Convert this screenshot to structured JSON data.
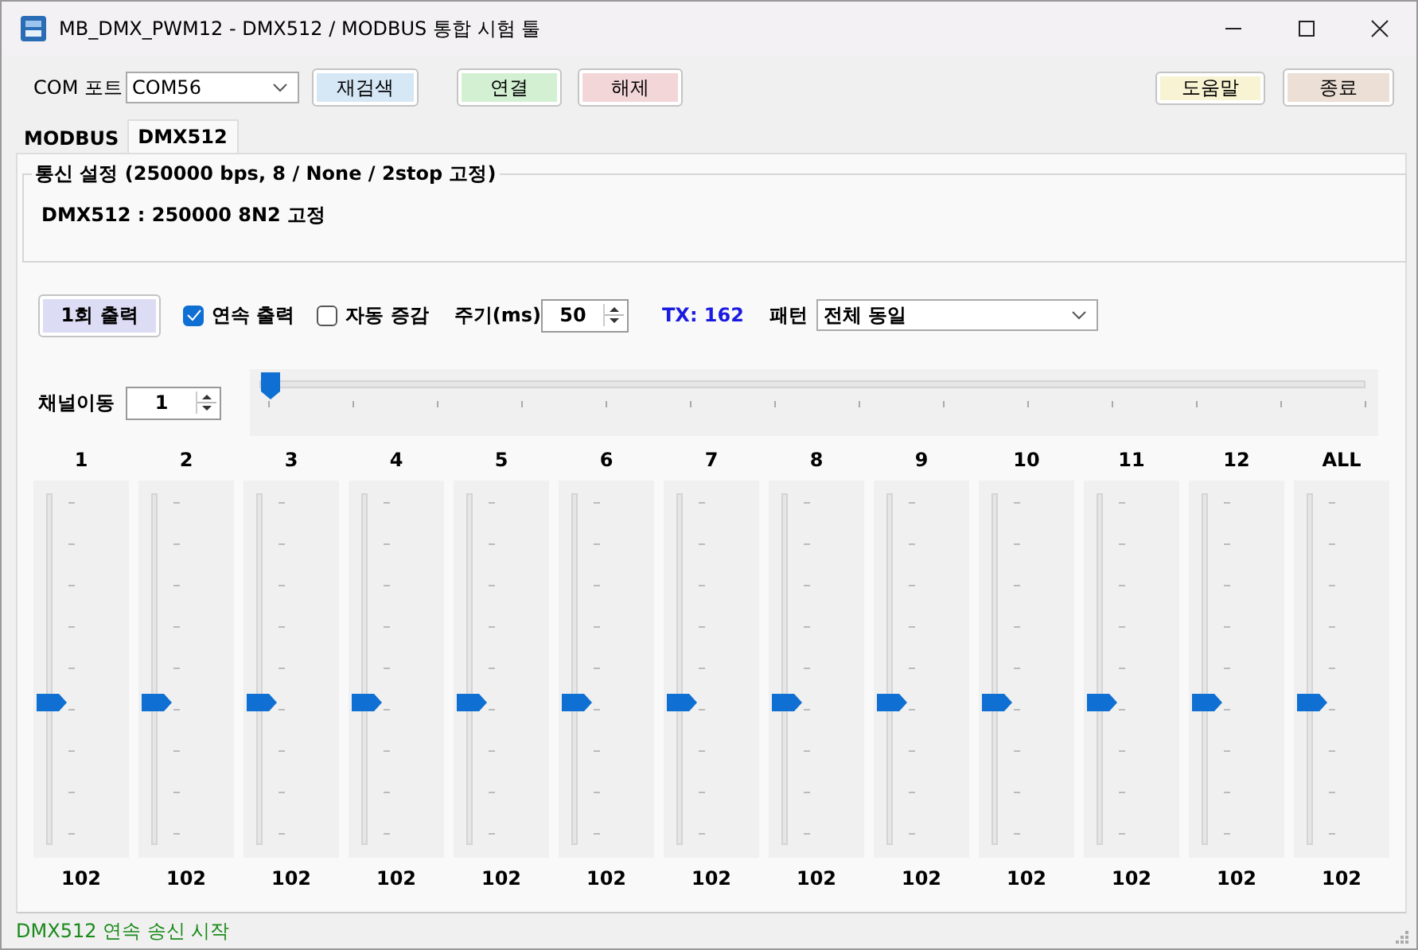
{
  "window": {
    "title": "MB_DMX_PWM12 - DMX512 / MODBUS 통합 시험 툴"
  },
  "toolbar": {
    "port_label": "COM 포트",
    "port": "COM56",
    "buttons": [
      {
        "label": "재검색",
        "color": "#d6e7f5"
      },
      {
        "label": "연결",
        "color": "#d3f0d3"
      },
      {
        "label": "해제",
        "color": "#f3d6d8"
      },
      {
        "label": "도움말",
        "color": "#f8f4d3"
      },
      {
        "label": "종료",
        "color": "#ecdfd6"
      }
    ]
  },
  "tabs": [
    {
      "label": "MODBUS",
      "selected": false
    },
    {
      "label": "DMX512",
      "selected": true
    }
  ],
  "settings_group": {
    "title": "통신 설정 (250000 bps, 8 / None / 2stop 고정)",
    "text": "DMX512 : 250000 8N2 고정"
  },
  "controls": {
    "once_button": "1회 출력",
    "continuous": {
      "label": "연속 출력",
      "checked": true
    },
    "auto_increment": {
      "label": "자동 증감",
      "checked": false
    },
    "period_label": "주기(ms)",
    "period": "50",
    "tx": "TX: 162",
    "pattern_label": "패턴",
    "pattern": "전체 동일"
  },
  "channel_shift": {
    "label": "채널이동",
    "value": "1",
    "level": 0
  },
  "channels": [
    {
      "name": "1",
      "level": 0.4,
      "value": "102"
    },
    {
      "name": "2",
      "level": 0.4,
      "value": "102"
    },
    {
      "name": "3",
      "level": 0.4,
      "value": "102"
    },
    {
      "name": "4",
      "level": 0.4,
      "value": "102"
    },
    {
      "name": "5",
      "level": 0.4,
      "value": "102"
    },
    {
      "name": "6",
      "level": 0.4,
      "value": "102"
    },
    {
      "name": "7",
      "level": 0.4,
      "value": "102"
    },
    {
      "name": "8",
      "level": 0.4,
      "value": "102"
    },
    {
      "name": "9",
      "level": 0.4,
      "value": "102"
    },
    {
      "name": "10",
      "level": 0.4,
      "value": "102"
    },
    {
      "name": "11",
      "level": 0.4,
      "value": "102"
    },
    {
      "name": "12",
      "level": 0.4,
      "value": "102"
    },
    {
      "name": "ALL",
      "level": 0.4,
      "value": "102"
    }
  ],
  "status_bar": "DMX512 연속 송신 시작"
}
